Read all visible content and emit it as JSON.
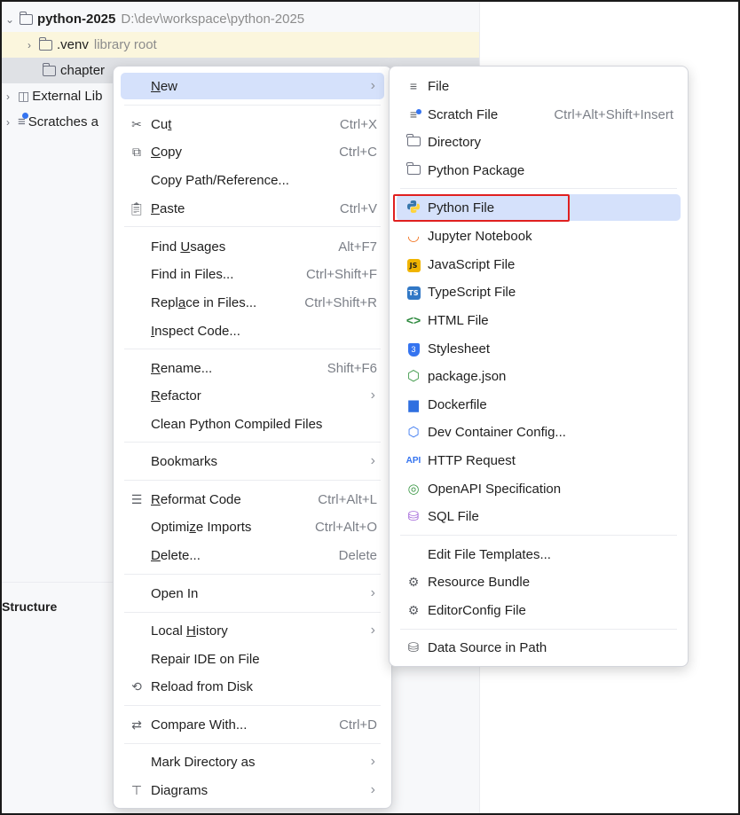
{
  "tree": {
    "rows": [
      {
        "label": "python-2025",
        "note": "D:\\dev\\workspace\\python-2025"
      },
      {
        "label": ".venv",
        "note": "library root"
      },
      {
        "label": "chapter"
      },
      {
        "label": "External Lib"
      },
      {
        "label": "Scratches a"
      }
    ],
    "structure_label": "Structure"
  },
  "context_menu": {
    "new": {
      "pre": "",
      "mn": "N",
      "post": "ew"
    },
    "cut": {
      "pre": "Cu",
      "mn": "t",
      "post": "",
      "shortcut": "Ctrl+X"
    },
    "copy": {
      "pre": "",
      "mn": "C",
      "post": "opy",
      "shortcut": "Ctrl+C"
    },
    "copy_path": "Copy Path/Reference...",
    "paste": {
      "pre": "",
      "mn": "P",
      "post": "aste",
      "shortcut": "Ctrl+V"
    },
    "find_usages": {
      "pre": "Find ",
      "mn": "U",
      "post": "sages",
      "shortcut": "Alt+F7"
    },
    "find_in_files": {
      "label": "Find in Files...",
      "shortcut": "Ctrl+Shift+F"
    },
    "replace_in_files": {
      "pre": "Repl",
      "mn": "a",
      "post": "ce in Files...",
      "shortcut": "Ctrl+Shift+R"
    },
    "inspect_code": {
      "pre": "",
      "mn": "I",
      "post": "nspect Code..."
    },
    "rename": {
      "pre": "",
      "mn": "R",
      "post": "ename...",
      "shortcut": "Shift+F6"
    },
    "refactor": {
      "pre": "",
      "mn": "R",
      "post": "efactor"
    },
    "clean_compiled": "Clean Python Compiled Files",
    "bookmarks": "Bookmarks",
    "reformat": {
      "pre": "",
      "mn": "R",
      "post": "eformat Code",
      "shortcut": "Ctrl+Alt+L"
    },
    "optimize": {
      "pre": "Optimi",
      "mn": "z",
      "post": "e Imports",
      "shortcut": "Ctrl+Alt+O"
    },
    "delete": {
      "pre": "",
      "mn": "D",
      "post": "elete...",
      "shortcut": "Delete"
    },
    "open_in": "Open In",
    "local_history": {
      "pre": "Local ",
      "mn": "H",
      "post": "istory"
    },
    "repair_ide": "Repair IDE on File",
    "reload": "Reload from Disk",
    "compare_with": {
      "label": "Compare With...",
      "shortcut": "Ctrl+D"
    },
    "mark_directory": "Mark Directory as",
    "diagrams": "Diagrams"
  },
  "new_submenu": {
    "file": {
      "label": "File",
      "icon": "file-lines-icon"
    },
    "scratch": {
      "label": "Scratch File",
      "shortcut": "Ctrl+Alt+Shift+Insert",
      "icon": "scratch-file-icon"
    },
    "directory": {
      "label": "Directory",
      "icon": "folder-icon"
    },
    "python_package": {
      "label": "Python Package",
      "icon": "python-package-icon"
    },
    "python_file": {
      "label": "Python File",
      "icon": "python-icon"
    },
    "jupyter": {
      "label": "Jupyter Notebook",
      "icon": "jupyter-icon"
    },
    "javascript": {
      "label": "JavaScript File",
      "icon": "js-icon",
      "badge": "JS"
    },
    "typescript": {
      "label": "TypeScript File",
      "icon": "ts-icon",
      "badge": "TS"
    },
    "html": {
      "label": "HTML File",
      "icon": "html-icon"
    },
    "stylesheet": {
      "label": "Stylesheet",
      "icon": "css-icon"
    },
    "package_json": {
      "label": "package.json",
      "icon": "nodejs-icon"
    },
    "dockerfile": {
      "label": "Dockerfile",
      "icon": "docker-icon"
    },
    "devcontainer": {
      "label": "Dev Container Config...",
      "icon": "cube-icon"
    },
    "http_request": {
      "label": "HTTP Request",
      "icon": "api-icon",
      "badge": "API"
    },
    "openapi": {
      "label": "OpenAPI Specification",
      "icon": "openapi-icon"
    },
    "sql": {
      "label": "SQL File",
      "icon": "database-icon"
    },
    "edit_templates": {
      "label": "Edit File Templates..."
    },
    "resource_bundle": {
      "label": "Resource Bundle",
      "icon": "gear-icon"
    },
    "editorconfig": {
      "label": "EditorConfig File",
      "icon": "gear-icon"
    },
    "data_source": {
      "label": "Data Source in Path",
      "icon": "database-icon"
    }
  },
  "colors": {
    "selection": "#d5e1fb",
    "highlight_box": "#e02020",
    "python_blue": "#3776ab",
    "python_yellow": "#ffd43b",
    "js_yellow": "#f0b400",
    "ts_blue": "#3178c6",
    "css_blue": "#3574f0"
  }
}
